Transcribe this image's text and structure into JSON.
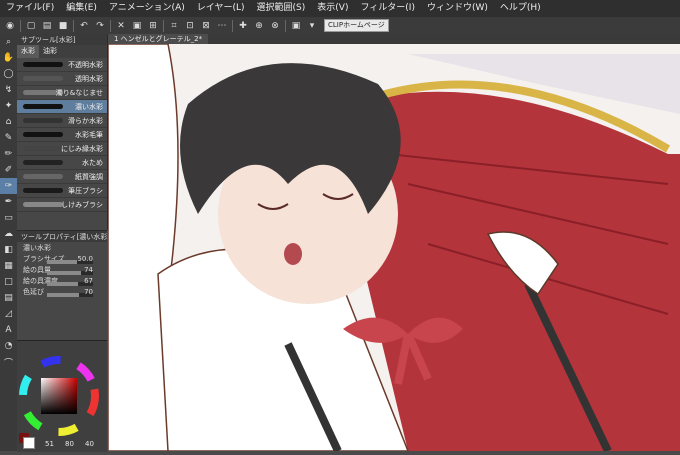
{
  "menu": {
    "items": [
      "ファイル(F)",
      "編集(E)",
      "アニメーション(A)",
      "レイヤー(L)",
      "選択範囲(S)",
      "表示(V)",
      "フィルター(I)",
      "ウィンドウ(W)",
      "ヘルプ(H)"
    ]
  },
  "toolbar": {
    "clip_homepage_label": "CLIPホームページ"
  },
  "subtool_panel": {
    "title": "サブツール[水彩]",
    "tabs": [
      "水彩",
      "油彩"
    ],
    "brushes": [
      {
        "label": "不透明水彩",
        "selected": false
      },
      {
        "label": "透明水彩",
        "selected": false
      },
      {
        "label": "濁り&なじませ",
        "selected": false
      },
      {
        "label": "濃い水彩",
        "selected": true
      },
      {
        "label": "滑らか水彩",
        "selected": false
      },
      {
        "label": "水彩毛筆",
        "selected": false
      },
      {
        "label": "にじみ縁水彩",
        "selected": false
      },
      {
        "label": "水ため",
        "selected": false
      },
      {
        "label": "紙質強調",
        "selected": false
      },
      {
        "label": "筆圧ブラシ",
        "selected": false
      },
      {
        "label": "しけみブラシ",
        "selected": false
      }
    ]
  },
  "tool_property": {
    "title": "ツールプロパティ[濃い水彩]",
    "subtitle": "濃い水彩",
    "rows": [
      {
        "label": "ブラシサイズ",
        "value": "50.0",
        "fraction": 0.65
      },
      {
        "label": "絵の具量",
        "value": "74",
        "fraction": 0.74
      },
      {
        "label": "絵の具濃度",
        "value": "67",
        "fraction": 0.67
      },
      {
        "label": "色延び",
        "value": "70",
        "fraction": 0.7
      }
    ]
  },
  "document": {
    "tab_label": "1 ヘンゼルとグレーテル_2*"
  },
  "color": {
    "main_color": "#7a1010",
    "bg_color": "#ffffff",
    "values": [
      "51",
      "80",
      "40"
    ]
  }
}
